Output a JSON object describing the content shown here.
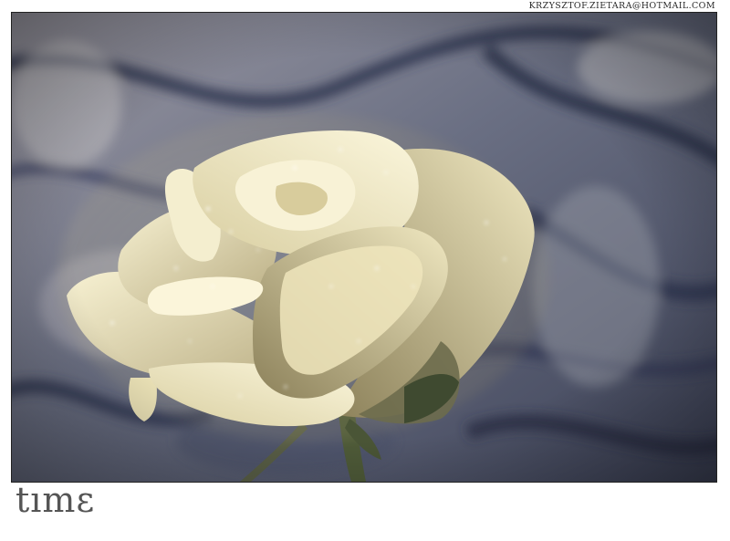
{
  "credit": "KRZYSZTOF.ZIETARA@HOTMAIL.COM",
  "caption": "tımɛ",
  "photo": {
    "subject": "rose-photo"
  },
  "colors": {
    "page_background": "#ffffff",
    "frame_border": "#222222",
    "backdrop_dark": "#3d4257",
    "backdrop_light": "#c9c7c9",
    "petal_light": "#f2ecc8",
    "petal_shadow": "#8c815a",
    "caption_color": "#555555"
  }
}
